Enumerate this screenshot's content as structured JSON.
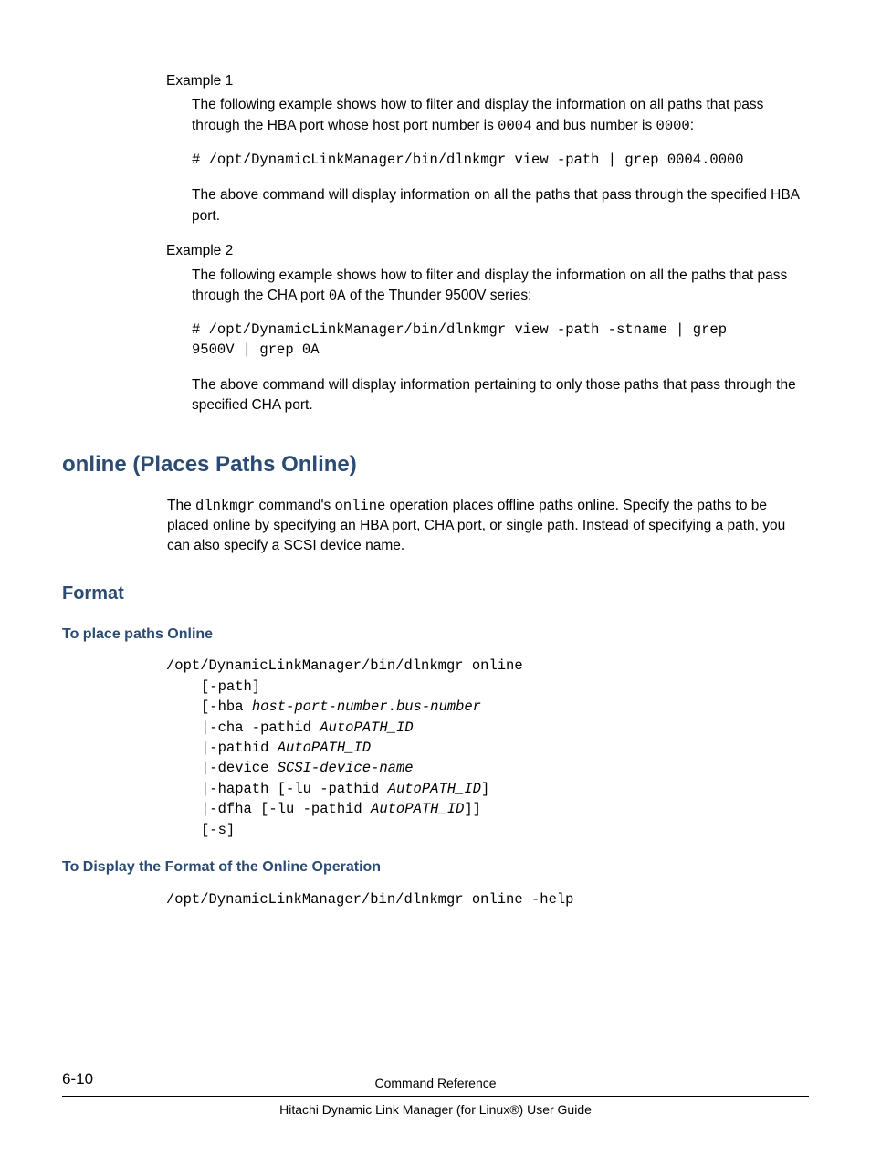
{
  "example1": {
    "label": "Example 1",
    "intro_pre": "The following example shows how to filter and display the information on all paths that pass through the HBA port whose host port number is ",
    "intro_code1": "0004",
    "intro_mid": " and bus number is ",
    "intro_code2": "0000",
    "intro_post": ":",
    "command": "# /opt/DynamicLinkManager/bin/dlnkmgr view -path | grep 0004.0000",
    "outro": "The above command will display information on all the paths that pass through the specified HBA port."
  },
  "example2": {
    "label": "Example 2",
    "intro_pre": "The following example shows how to filter and display the information on all the paths that pass through the CHA port ",
    "intro_code1": "0A",
    "intro_post": " of the Thunder 9500V series:",
    "command": "# /opt/DynamicLinkManager/bin/dlnkmgr view -path -stname | grep 9500V | grep 0A",
    "outro": "The above command will display information pertaining to only those paths that pass through the specified CHA port."
  },
  "section": {
    "title": "online (Places Paths Online)",
    "intro_pre": "The ",
    "intro_c1": "dlnkmgr",
    "intro_mid1": " command's ",
    "intro_c2": "online",
    "intro_post": " operation places offline paths online. Specify the paths to be placed online by specifying an HBA port, CHA port, or single path. Instead of specifying a path, you can also specify a SCSI device name."
  },
  "format": {
    "title": "Format",
    "sub1": {
      "title": "To place paths Online",
      "line0": "/opt/DynamicLinkManager/bin/dlnkmgr online",
      "lines": [
        {
          "pre": "[-path]"
        },
        {
          "pre": "[-hba ",
          "it": "host-port-number",
          "mid": ".",
          "it2": "bus-number"
        },
        {
          "pre": "|-cha -pathid ",
          "it": "AutoPATH_ID"
        },
        {
          "pre": "|-pathid ",
          "it": "AutoPATH_ID"
        },
        {
          "pre": "|-device ",
          "it": "SCSI-device-name"
        },
        {
          "pre": "|-hapath [-lu -pathid ",
          "it": "AutoPATH_ID",
          "post": "]"
        },
        {
          "pre": "|-dfha [-lu -pathid ",
          "it": "AutoPATH_ID",
          "post": "]]"
        },
        {
          "pre": "[-s]"
        }
      ]
    },
    "sub2": {
      "title": "To Display the Format of the Online Operation",
      "command": "/opt/DynamicLinkManager/bin/dlnkmgr online -help"
    }
  },
  "footer": {
    "page": "6-10",
    "top": "Command Reference",
    "bottom": "Hitachi Dynamic Link Manager (for Linux®) User Guide"
  }
}
